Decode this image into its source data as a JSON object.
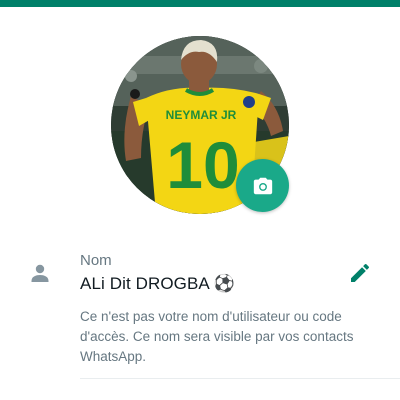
{
  "colors": {
    "accent": "#008069",
    "fab": "#1aa989",
    "label": "#667781",
    "text": "#111b21"
  },
  "profile": {
    "photo_icon": "profile-photo",
    "jersey_name": "NEYMAR JR",
    "jersey_number": "10",
    "camera_icon": "camera-icon"
  },
  "name_field": {
    "icon": "person-icon",
    "label": "Nom",
    "value": "ALi Dit DROGBA ⚽",
    "edit_icon": "pencil-icon",
    "hint": "Ce n'est pas votre nom d'utilisateur ou code d'accès. Ce nom sera visible par vos contacts WhatsApp."
  }
}
